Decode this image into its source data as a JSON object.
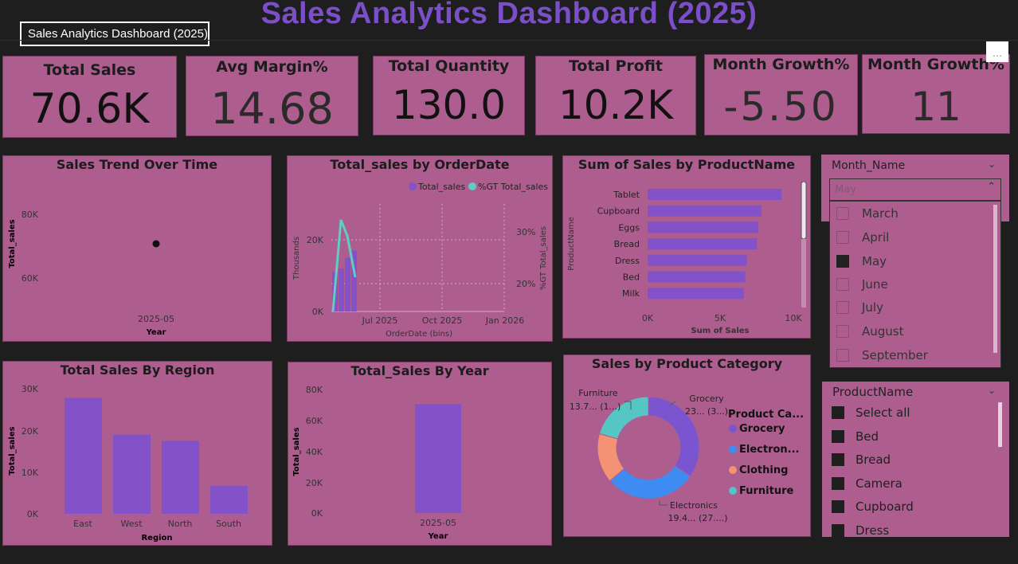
{
  "header": {
    "title": "Sales Analytics Dashboard (2025)",
    "tooltip": "Sales Analytics Dashboard (2025)"
  },
  "kpis": [
    {
      "label": "Total Sales",
      "value": "70.6K"
    },
    {
      "label": "Avg Margin%",
      "value": "14.68"
    },
    {
      "label": "Total Quantity",
      "value": "130.0"
    },
    {
      "label": "Total Profit",
      "value": "10.2K"
    },
    {
      "label": "Month Growth%",
      "value": "-5.50"
    },
    {
      "label": "Month Growth%",
      "value": "11"
    }
  ],
  "charts": {
    "trend": {
      "title": "Sales Trend Over Time",
      "ylabel": "Total_sales",
      "xlabel": "Year",
      "yticks": [
        "80K",
        "60K"
      ],
      "xtick": "2025-05"
    },
    "orderdate": {
      "title": "Total_sales by OrderDate",
      "legend": [
        "Total_sales",
        "%GT Total_sales"
      ],
      "yleft": "Thousands",
      "yright": "%GT Total_sales",
      "xlabel": "OrderDate (bins)",
      "yticks": [
        "20K",
        "0K"
      ],
      "rticks": [
        "30%",
        "20%"
      ],
      "xticks": [
        "Jul 2025",
        "Oct 2025",
        "Jan 2026"
      ]
    },
    "product": {
      "title": "Sum of Sales by ProductName",
      "ylabel": "ProductName",
      "xlabel": "Sum of Sales",
      "xticks": [
        "0K",
        "5K",
        "10K"
      ]
    },
    "region": {
      "title": "Total Sales By Region",
      "ylabel": "Total_sales",
      "xlabel": "Region",
      "yticks": [
        "30K",
        "20K",
        "10K",
        "0K"
      ]
    },
    "year": {
      "title": "Total_Sales By Year",
      "ylabel": "Total_sales",
      "xlabel": "Year",
      "yticks": [
        "80K",
        "60K",
        "40K",
        "20K",
        "0K"
      ],
      "xtick": "2025-05"
    },
    "category": {
      "title": "Sales by Product Category",
      "legend_title": "Product Ca...",
      "labels": {
        "furniture": [
          "Furniture",
          "13.7... (1...)"
        ],
        "grocery": [
          "Grocery",
          "23... (3...)"
        ],
        "electronics": [
          "Electronics",
          "19.4... (27....)"
        ]
      }
    }
  },
  "chart_data": [
    {
      "type": "scatter",
      "title": "Sales Trend Over Time",
      "xlabel": "Year",
      "ylabel": "Total_sales",
      "x": [
        "2025-05"
      ],
      "y": [
        70600
      ],
      "ylim": [
        50000,
        85000
      ]
    },
    {
      "type": "bar",
      "title": "Total_sales by OrderDate",
      "xlabel": "OrderDate (bins)",
      "ylabel": "Thousands",
      "series": [
        {
          "name": "Total_sales",
          "values": [
            11000,
            12000,
            15000,
            17000
          ]
        },
        {
          "name": "%GT Total_sales",
          "values": [
            0.19,
            0.32,
            0.29,
            0.23
          ]
        }
      ],
      "ylim": [
        0,
        30000
      ],
      "xticks": [
        "Jul 2025",
        "Oct 2025",
        "Jan 2026"
      ]
    },
    {
      "type": "bar",
      "title": "Sum of Sales by ProductName",
      "xlabel": "Sum of Sales",
      "ylabel": "ProductName",
      "categories": [
        "Tablet",
        "Cupboard",
        "Eggs",
        "Bread",
        "Dress",
        "Bed",
        "Milk"
      ],
      "values": [
        9200,
        7800,
        7600,
        7500,
        6800,
        6700,
        6600
      ],
      "xlim": [
        0,
        10500
      ]
    },
    {
      "type": "bar",
      "title": "Total Sales By Region",
      "xlabel": "Region",
      "ylabel": "Total_sales",
      "categories": [
        "East",
        "West",
        "North",
        "South"
      ],
      "values": [
        27800,
        19000,
        17500,
        6700
      ],
      "ylim": [
        0,
        30000
      ]
    },
    {
      "type": "bar",
      "title": "Total_Sales By Year",
      "xlabel": "Year",
      "ylabel": "Total_sales",
      "categories": [
        "2025-05"
      ],
      "values": [
        70600
      ],
      "ylim": [
        0,
        80000
      ]
    },
    {
      "type": "pie",
      "title": "Sales by Product Category",
      "categories": [
        "Grocery",
        "Electronics",
        "Clothing",
        "Furniture"
      ],
      "values": [
        23.0,
        19.4,
        10.5,
        13.7
      ],
      "colors": [
        "#7b55d0",
        "#3e8cf2",
        "#f49274",
        "#55c6c4"
      ]
    }
  ],
  "slicers": {
    "month": {
      "header": "Month_Name",
      "selected": "May",
      "options": [
        {
          "label": "March",
          "checked": false
        },
        {
          "label": "April",
          "checked": false
        },
        {
          "label": "May",
          "checked": true
        },
        {
          "label": "June",
          "checked": false
        },
        {
          "label": "July",
          "checked": false
        },
        {
          "label": "August",
          "checked": false
        },
        {
          "label": "September",
          "checked": false
        }
      ]
    },
    "product": {
      "header": "ProductName",
      "options": [
        {
          "label": "Select all"
        },
        {
          "label": "Bed"
        },
        {
          "label": "Bread"
        },
        {
          "label": "Camera"
        },
        {
          "label": "Cupboard"
        },
        {
          "label": "Dress"
        }
      ]
    }
  },
  "colors": {
    "card": "#ad5e8f",
    "bar": "#8452c8",
    "title": "#7b4fc8",
    "line": "#5ecdc4"
  }
}
